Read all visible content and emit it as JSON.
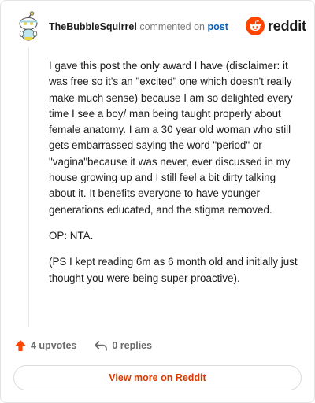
{
  "header": {
    "author": "TheBubbleSquirrel",
    "commented_text": "commented on",
    "post_link": "post",
    "brand": "reddit"
  },
  "comment": {
    "paragraphs": [
      "I gave this post the only award I have (disclaimer: it was free so it's an \"excited\" one which doesn't really make much sense) because I am so delighted every time I see a boy/ man being taught properly about female anatomy. I am a 30 year old woman who still gets embarrassed saying the word \"period\" or \"vagina\"because it was never, ever discussed in my house growing up and I still feel a bit dirty talking about it. It benefits everyone to have younger generations educated, and the stigma removed.",
      "OP: NTA.",
      "(PS I kept reading 6m as 6 month old and initially just thought you were being super proactive)."
    ]
  },
  "actions": {
    "upvotes_label": "4 upvotes",
    "replies_label": "0 replies"
  },
  "footer": {
    "view_more_label": "View more on Reddit"
  },
  "colors": {
    "brand_orange": "#ff4500",
    "upvote_orange": "#ff4500",
    "link_blue": "#0a5fb6",
    "view_more_text": "#d93a00"
  },
  "icons": {
    "avatar": "snoo-avatar-icon",
    "logo": "reddit-logo-icon",
    "upvote": "upvote-arrow-icon",
    "reply": "reply-arrow-icon"
  }
}
